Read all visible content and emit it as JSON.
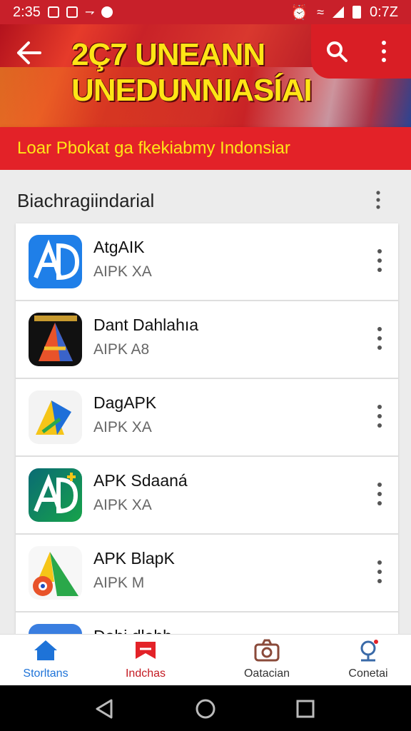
{
  "status_bar": {
    "time": "2:35",
    "right_text": "0:7Z"
  },
  "banner": {
    "title": "2Ç7 UNEANN\nUNEDUNNIASÍAI"
  },
  "subheader": {
    "text": "Loar Pbokat ga fkekiabmy Indonsiar"
  },
  "section": {
    "title": "Biachragiindarial"
  },
  "apps": [
    {
      "name": "AtgAIK",
      "subtitle": "AIPK XA",
      "icon": "ad-blue-icon"
    },
    {
      "name": "Dant Dahlahıa",
      "subtitle": "AIPK A8",
      "icon": "a-triangle-dark-icon"
    },
    {
      "name": "DagAPK",
      "subtitle": "AIPK XA",
      "icon": "ap-yellow-blue-icon"
    },
    {
      "name": "APK Sdaaná",
      "subtitle": "AIPK XA",
      "icon": "ad-green-icon"
    },
    {
      "name": "APK BlapK",
      "subtitle": "AIPK M",
      "icon": "a-gear-icon"
    },
    {
      "name": "Dahi dlahh",
      "subtitle": "",
      "icon": "partial-app-icon"
    }
  ],
  "bottom_nav": [
    {
      "label": "Storltans",
      "icon": "home-icon",
      "active": true
    },
    {
      "label": "Indchas",
      "icon": "bookmark-icon",
      "active": false
    },
    {
      "label": "Oatacian",
      "icon": "camera-icon",
      "active": false
    },
    {
      "label": "Conetai",
      "icon": "contact-icon",
      "active": false
    }
  ],
  "colors": {
    "primary": "#e32228",
    "accent": "#ffe516",
    "nav_active": "#1e73d8"
  }
}
